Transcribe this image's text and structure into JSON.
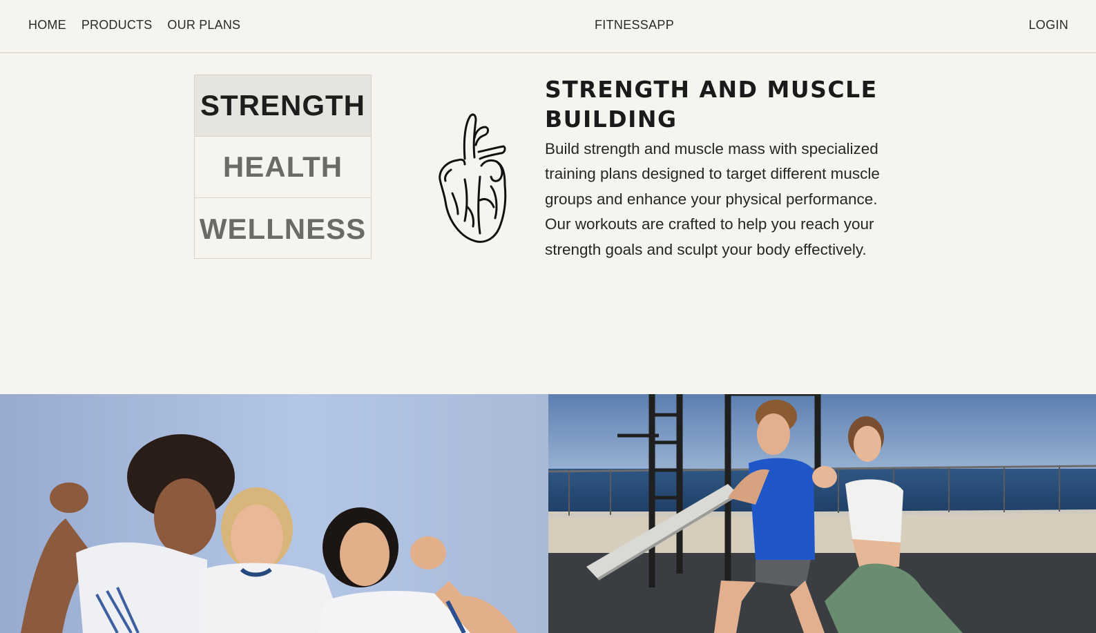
{
  "header": {
    "nav": [
      "HOME",
      "PRODUCTS",
      "OUR PLANS"
    ],
    "brand": "FITNESSAPP",
    "login": "LOGIN"
  },
  "tabs": [
    {
      "label": "STRENGTH",
      "active": true
    },
    {
      "label": "HEALTH",
      "active": false
    },
    {
      "label": "WELLNESS",
      "active": false
    }
  ],
  "feature": {
    "icon": "heart-icon",
    "title": "STRENGTH AND MUSCLE BUILDING",
    "description": "Build strength and muscle mass with specialized training plans designed to target different muscle groups and enhance your physical performance. Our workouts are crafted to help you reach your strength goals and sculpt your body effectively."
  },
  "images": [
    {
      "name": "group-women-celebrating-photo"
    },
    {
      "name": "couple-lunges-outdoor-photo"
    }
  ],
  "colors": {
    "background": "#f6f4ee",
    "active_tab": "#e6e4de",
    "text": "#1f1f1f"
  }
}
